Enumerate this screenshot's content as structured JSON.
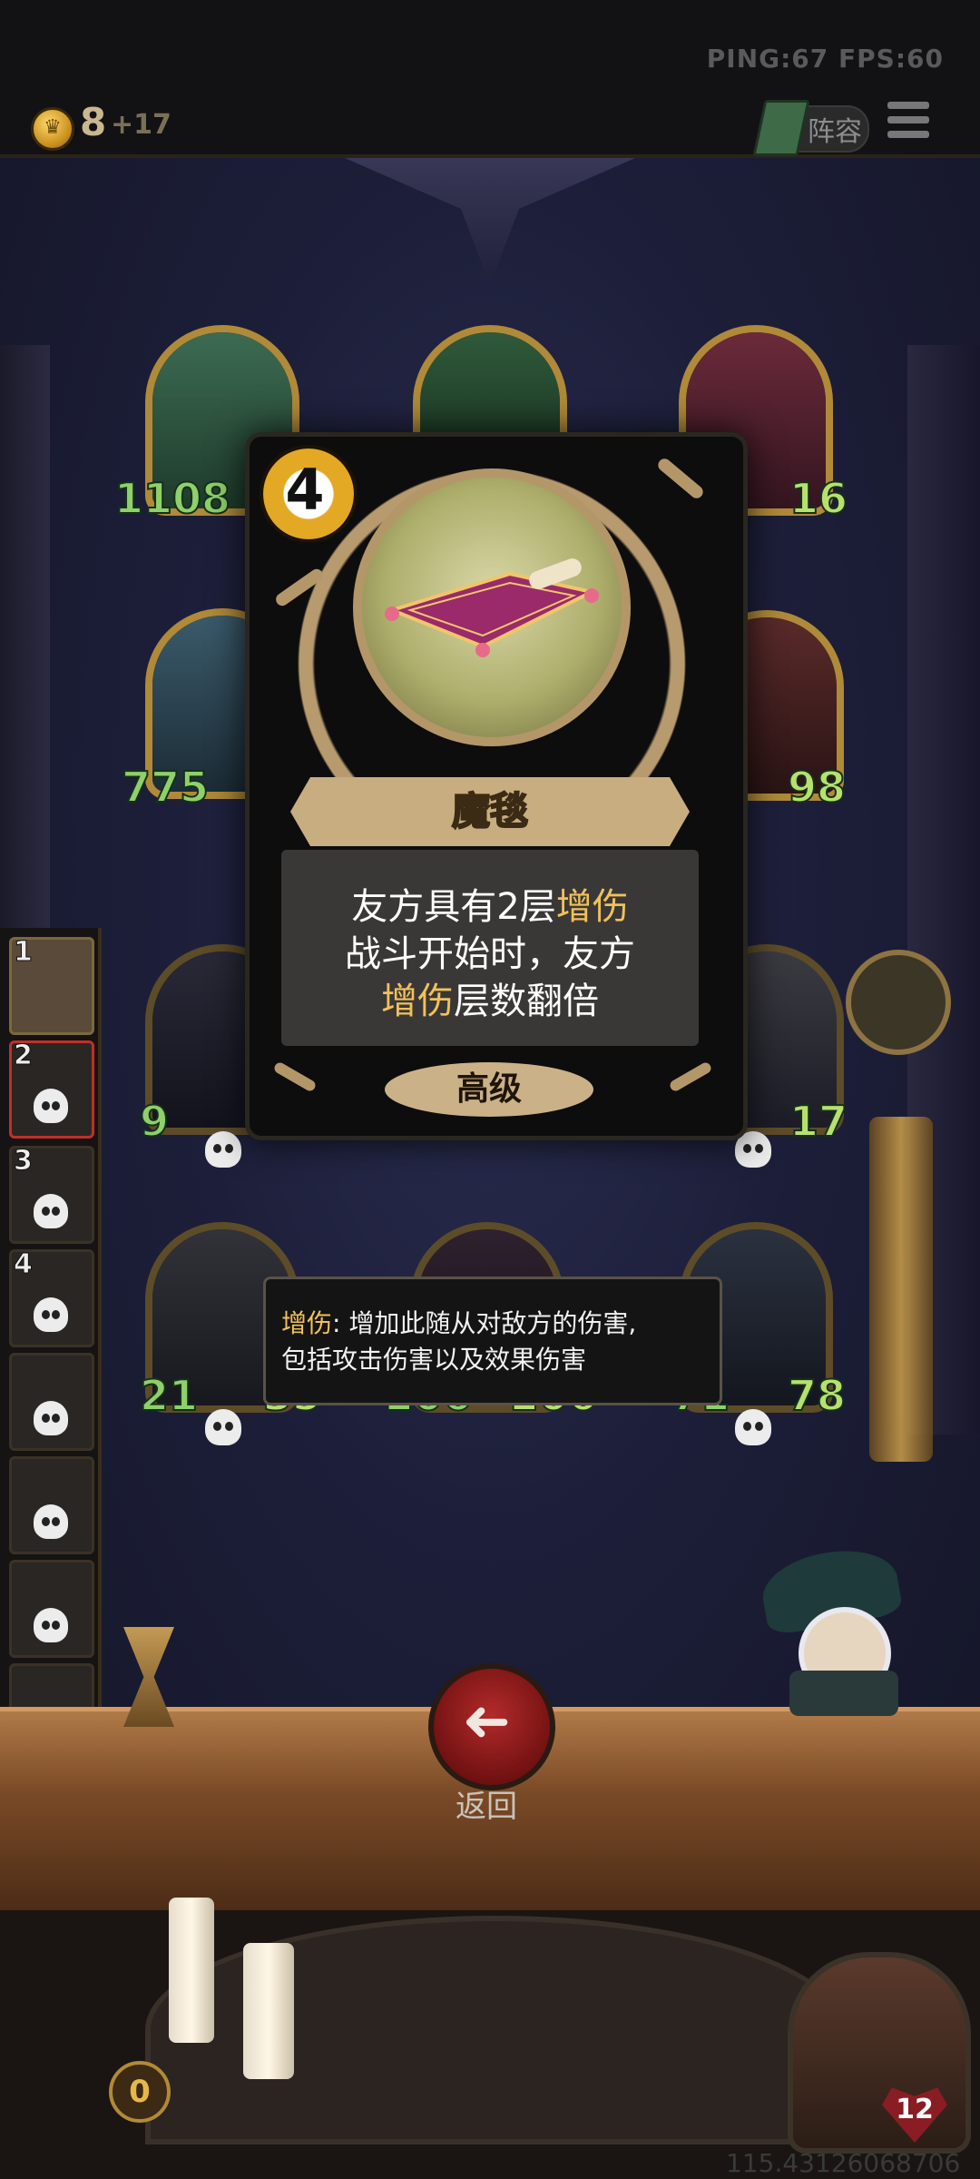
{
  "topbar": {
    "ping_fps": "PING:67   FPS:60",
    "gold": "8",
    "gold_income": "+17",
    "lineup_label": "阵容"
  },
  "board": {
    "enemy_row1": [
      {
        "attack": "1108",
        "health": ""
      },
      {
        "attack": "",
        "health": ""
      },
      {
        "attack": "",
        "health": "16"
      }
    ],
    "enemy_row2": [
      {
        "attack": "775",
        "health": ""
      },
      {
        "attack": "",
        "health": "98"
      }
    ],
    "friendly_row": [
      {
        "attack": "9",
        "health": ""
      },
      {
        "attack": "",
        "health": "17"
      }
    ],
    "bottom_row": [
      {
        "attack": "21",
        "health": "35"
      },
      {
        "attack": "206",
        "health": "206"
      },
      {
        "attack": "71",
        "health": "78"
      }
    ]
  },
  "bench": {
    "slots": [
      {
        "number": "1"
      },
      {
        "number": "2"
      },
      {
        "number": "3"
      },
      {
        "number": "4"
      },
      {
        "number": ""
      },
      {
        "number": ""
      },
      {
        "number": ""
      },
      {
        "number": ""
      }
    ]
  },
  "card": {
    "cost": "4",
    "name": "魔毯",
    "desc_line1_pre": "友方具有2层",
    "desc_line1_kw": "增伤",
    "desc_line2": "战斗开始时，友方",
    "desc_line3_kw": "增伤",
    "desc_line3_post": "层数翻倍",
    "tier": "高级"
  },
  "tooltip": {
    "keyword": "增伤",
    "line1_rest": ": 增加此随从对敌方的伤害,",
    "line2": "包括攻击伤害以及效果伤害"
  },
  "back": {
    "arrow": "➜",
    "label": "返回"
  },
  "hero": {
    "health": "12"
  },
  "shop": {
    "counter": "0"
  },
  "footer": {
    "coordinates": "115.43126068706"
  },
  "colors": {
    "keyword": "#f1c15a",
    "card_bg": "#0e0d0d",
    "frame_gold": "#b39769",
    "back_red": "#b32a2a"
  }
}
